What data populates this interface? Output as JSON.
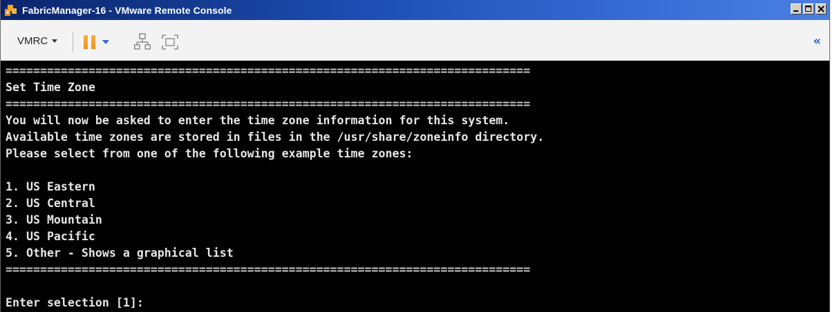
{
  "window": {
    "title": "FabricManager-16 - VMware Remote Console",
    "controls": [
      "minimize",
      "maximize",
      "close"
    ]
  },
  "toolbar": {
    "vmrc_label": "VMRC",
    "icons": [
      "pause-icon",
      "network-icon",
      "fit-window-icon",
      "collapse-icon"
    ],
    "collapse_glyph": "«"
  },
  "console": {
    "lines": [
      "============================================================================",
      "Set Time Zone",
      "============================================================================",
      "You will now be asked to enter the time zone information for this system.",
      "Available time zones are stored in files in the /usr/share/zoneinfo directory.",
      "Please select from one of the following example time zones:",
      "",
      "1. US Eastern",
      "2. US Central",
      "3. US Mountain",
      "4. US Pacific",
      "5. Other - Shows a graphical list",
      "============================================================================",
      "",
      "Enter selection [1]:"
    ]
  },
  "colors": {
    "titlebar_start": "#0a246a",
    "titlebar_end": "#4a7fe0",
    "console_bg": "#000000",
    "console_fg": "#e6e6e6",
    "pause_accent": "#f0901a"
  }
}
